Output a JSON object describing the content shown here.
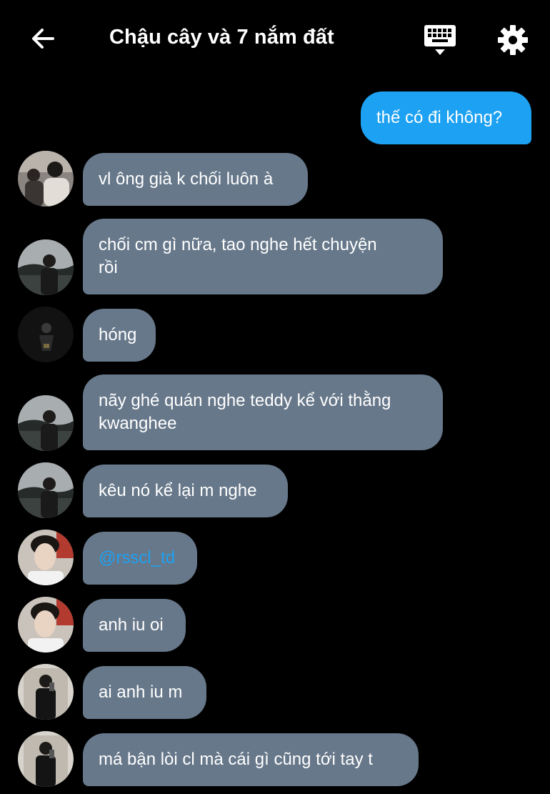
{
  "header": {
    "title": "Chậu cây và 7 nắm đất",
    "back_icon": "arrow-left-icon",
    "keyboard_icon": "keyboard-icon",
    "settings_icon": "gear-icon"
  },
  "colors": {
    "background": "#000000",
    "outgoing_bubble": "#1da1f2",
    "incoming_bubble": "#67788a",
    "mention": "#1da1f2"
  },
  "messages": [
    {
      "direction": "out",
      "text": "thế có đi không?"
    },
    {
      "direction": "in",
      "avatar": "avatar-group-photo",
      "text": "vl ông già k chối luôn à"
    },
    {
      "direction": "in",
      "avatar": "avatar-man-outdoor",
      "text": "chối cm gì nữa, tao nghe hết chuyện\nrồi"
    },
    {
      "direction": "in",
      "avatar": "avatar-dark-silhouette",
      "text": "hóng"
    },
    {
      "direction": "in",
      "avatar": "avatar-man-outdoor",
      "text": "nãy ghé quán nghe teddy kể với thằng\nkwanghee"
    },
    {
      "direction": "in",
      "avatar": "avatar-man-outdoor",
      "text": "kêu nó kể lại m nghe"
    },
    {
      "direction": "in",
      "avatar": "avatar-portrait-red",
      "text": "@rsscl_td",
      "mention": true
    },
    {
      "direction": "in",
      "avatar": "avatar-portrait-red",
      "text": "anh iu oi"
    },
    {
      "direction": "in",
      "avatar": "avatar-mirror-selfie",
      "text": "ai anh iu m"
    },
    {
      "direction": "in",
      "avatar": "avatar-mirror-selfie",
      "text": "má bận lòi cl mà cái gì cũng tới tay t"
    }
  ]
}
